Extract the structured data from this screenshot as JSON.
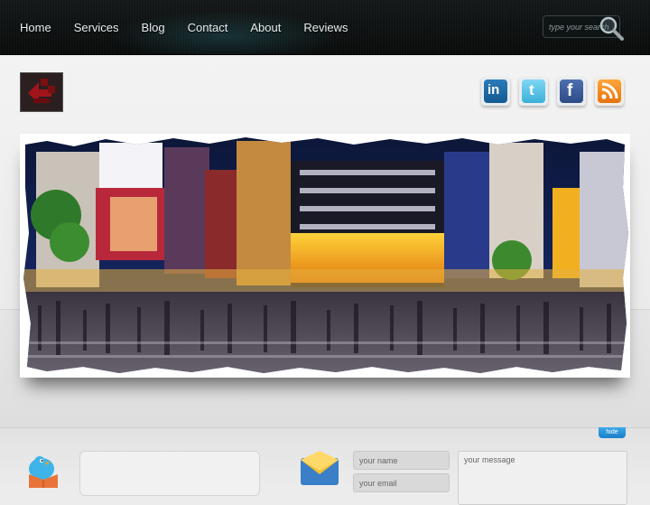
{
  "nav": {
    "items": [
      {
        "label": "Home"
      },
      {
        "label": "Services"
      },
      {
        "label": "Blog"
      },
      {
        "label": "Contact"
      },
      {
        "label": "About"
      },
      {
        "label": "Reviews"
      }
    ]
  },
  "search": {
    "placeholder": "type your search"
  },
  "social": {
    "icons": [
      "linkedin-icon",
      "twitter-icon",
      "facebook-icon",
      "rss-icon"
    ],
    "labels": {
      "linkedin": "in",
      "twitter": "t",
      "facebook": "f"
    }
  },
  "footer": {
    "hide_label": "hide",
    "contact": {
      "name_placeholder": "your name",
      "email_placeholder": "your email",
      "message_placeholder": "your message"
    }
  },
  "colors": {
    "accent": "#1a7fc8",
    "nav_text": "#e9eef0"
  }
}
